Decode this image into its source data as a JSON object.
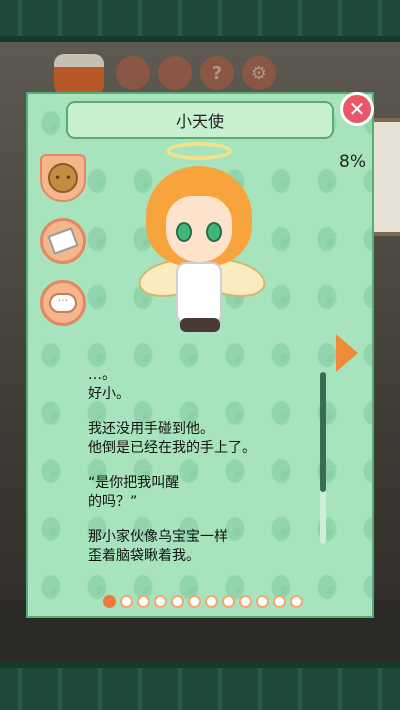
{
  "dialog": {
    "title": "小天使",
    "progress_percent": "8%",
    "close_icon": "✕"
  },
  "side_buttons": [
    {
      "name": "cookie-icon"
    },
    {
      "name": "book-icon"
    },
    {
      "name": "chat-bubble-icon",
      "glyph": "···"
    }
  ],
  "story": {
    "lines": [
      "…。",
      "好小。",
      "",
      "我还没用手碰到他。",
      "他倒是已经在我的手上了。",
      "",
      "“是你把我叫醒",
      "的吗？”",
      "",
      "那小家伙像乌宝宝一样",
      "歪着脑袋瞅着我。"
    ]
  },
  "pagination": {
    "total": 12,
    "current": 1
  },
  "background_icons": [
    "new-badge",
    "?",
    "gear"
  ],
  "colors": {
    "panel": "#a7e4bd",
    "accent_orange": "#f08a3a",
    "close_red": "#e85767"
  }
}
